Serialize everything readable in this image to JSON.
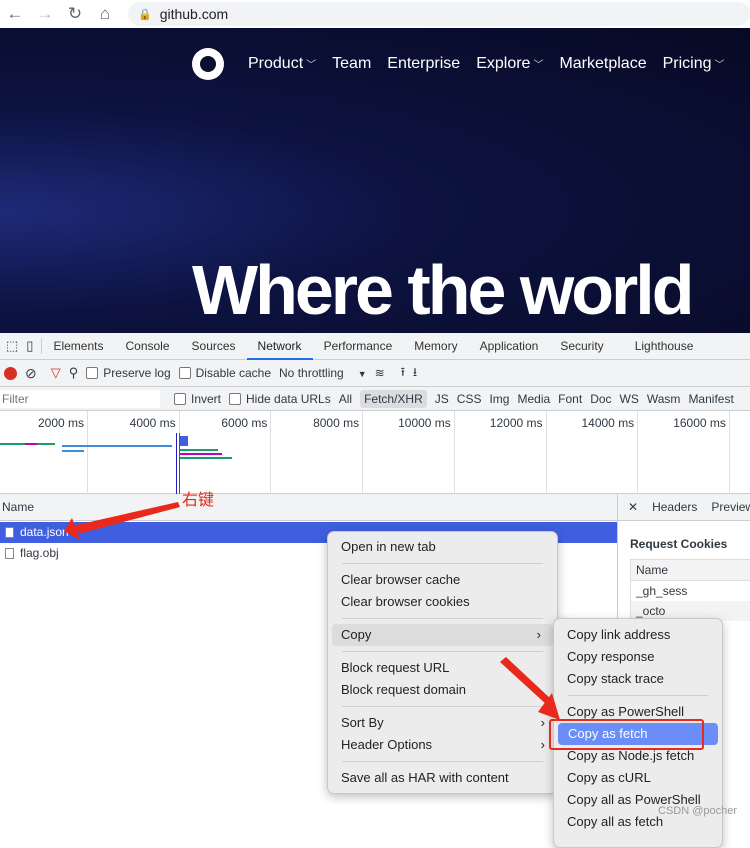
{
  "browser": {
    "url": "github.com"
  },
  "github": {
    "nav": [
      "Product",
      "Team",
      "Enterprise",
      "Explore",
      "Marketplace",
      "Pricing"
    ],
    "headline": "Where the world"
  },
  "devtools": {
    "tabs": [
      "Elements",
      "Console",
      "Sources",
      "Network",
      "Performance",
      "Memory",
      "Application",
      "Security",
      "Lighthouse"
    ],
    "toolbar": {
      "preserve_log": "Preserve log",
      "disable_cache": "Disable cache",
      "throttling": "No throttling"
    },
    "filter": {
      "placeholder": "Filter",
      "invert": "Invert",
      "hide_data_urls": "Hide data URLs",
      "types": [
        "All",
        "Fetch/XHR",
        "JS",
        "CSS",
        "Img",
        "Media",
        "Font",
        "Doc",
        "WS",
        "Wasm",
        "Manifest"
      ]
    },
    "timeline": [
      "2000 ms",
      "4000 ms",
      "6000 ms",
      "8000 ms",
      "10000 ms",
      "12000 ms",
      "14000 ms",
      "16000 ms"
    ],
    "name_header": "Name",
    "requests": [
      "data.json",
      "flag.obj"
    ],
    "right_panel": {
      "tabs": [
        "Headers",
        "Preview"
      ],
      "section": "Request Cookies",
      "col": "Name",
      "cookies": [
        "_gh_sess",
        "_octo"
      ]
    }
  },
  "context_menu": {
    "items": [
      "Open in new tab",
      "Clear browser cache",
      "Clear browser cookies",
      "Copy",
      "Block request URL",
      "Block request domain",
      "Sort By",
      "Header Options",
      "Save all as HAR with content"
    ]
  },
  "copy_submenu": {
    "items": [
      "Copy link address",
      "Copy response",
      "Copy stack trace",
      "Copy as PowerShell",
      "Copy as fetch",
      "Copy as Node.js fetch",
      "Copy as cURL",
      "Copy all as PowerShell",
      "Copy all as fetch"
    ]
  },
  "annotation": "右键",
  "watermark": "CSDN @pocher",
  "colors": {
    "accent": "#1a73e8",
    "selected_row": "#3f5fe0",
    "menu_highlight": "#6a8df7",
    "arrow": "#e8291c"
  }
}
